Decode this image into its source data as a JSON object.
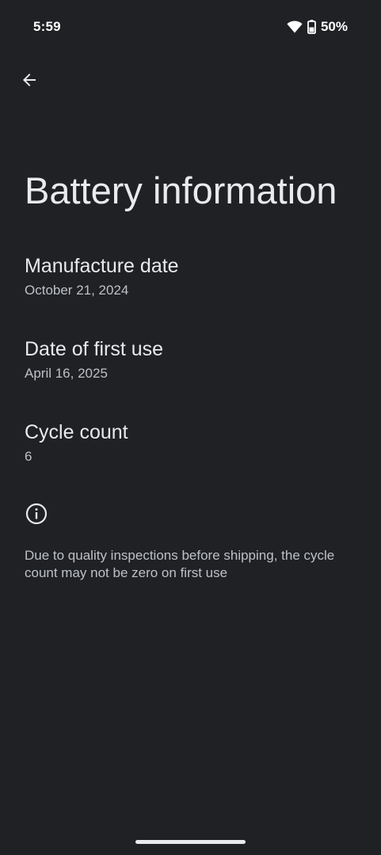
{
  "status_bar": {
    "time": "5:59",
    "battery_percent": "50%",
    "icons": [
      "wifi-icon",
      "battery-icon"
    ]
  },
  "toolbar": {
    "back_icon": "arrow-back-icon"
  },
  "page": {
    "title": "Battery information"
  },
  "items": [
    {
      "title": "Manufacture date",
      "value": "October 21, 2024"
    },
    {
      "title": "Date of first use",
      "value": "April 16, 2025"
    },
    {
      "title": "Cycle count",
      "value": "6"
    }
  ],
  "footer": {
    "icon": "info-icon",
    "note": "Due to quality inspections before shipping, the cycle count may not be zero on first use"
  },
  "colors": {
    "background": "#202124",
    "primary_text": "#e8eaed",
    "secondary_text": "#bdc1c6"
  }
}
